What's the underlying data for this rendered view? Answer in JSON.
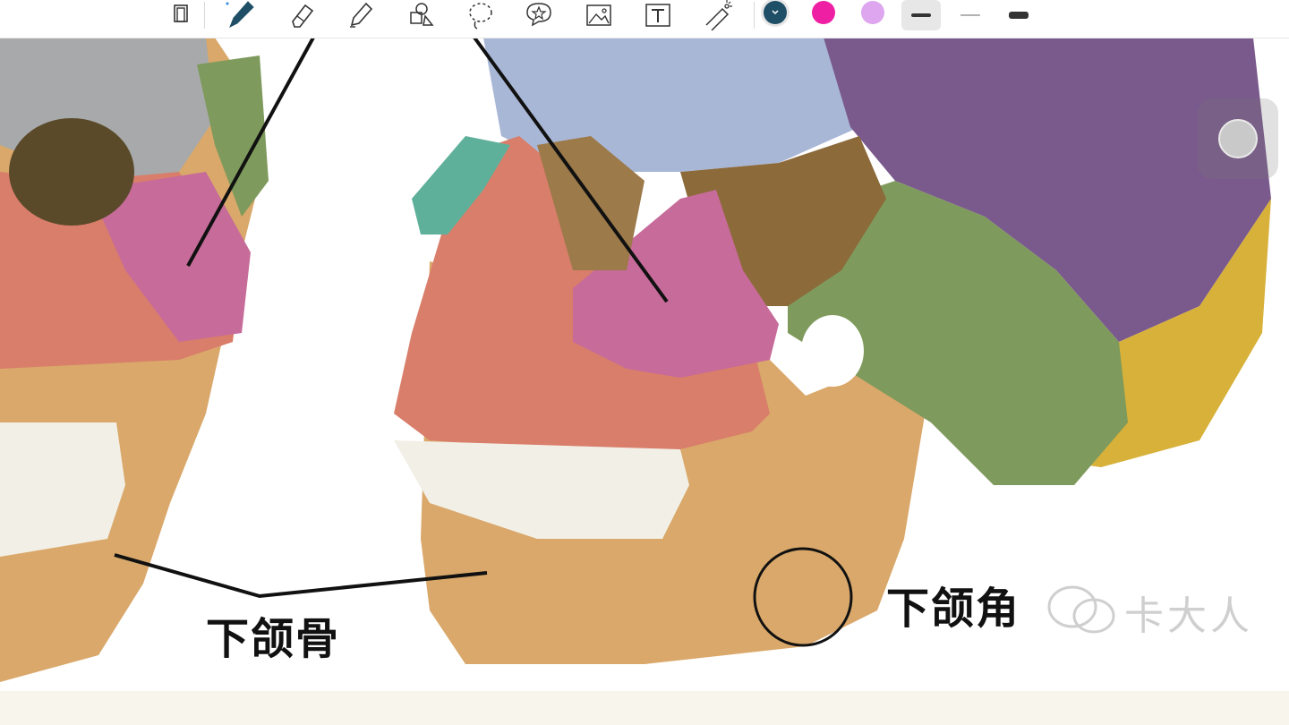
{
  "toolbar": {
    "tools": [
      {
        "icon": "page-view-icon"
      },
      {
        "icon": "pen-icon",
        "selected": true
      },
      {
        "icon": "eraser-icon"
      },
      {
        "icon": "highlighter-icon"
      },
      {
        "icon": "shapes-icon"
      },
      {
        "icon": "lasso-icon"
      },
      {
        "icon": "sticker-icon"
      },
      {
        "icon": "image-icon"
      },
      {
        "icon": "text-icon"
      },
      {
        "icon": "laser-pointer-icon"
      }
    ],
    "colors": [
      "#1f4f66",
      "#ee1fa3",
      "#dda6ef"
    ],
    "selected_color": "#1f4f66",
    "stroke_widths": [
      "thick",
      "thin",
      "bold"
    ],
    "selected_stroke": "thick"
  },
  "canvas": {
    "labels": {
      "mandible": "下颌骨",
      "mandible_angle": "下颌角"
    },
    "watermark": "卡大人"
  },
  "floating_button": {
    "icon": "assistive-touch-icon"
  }
}
